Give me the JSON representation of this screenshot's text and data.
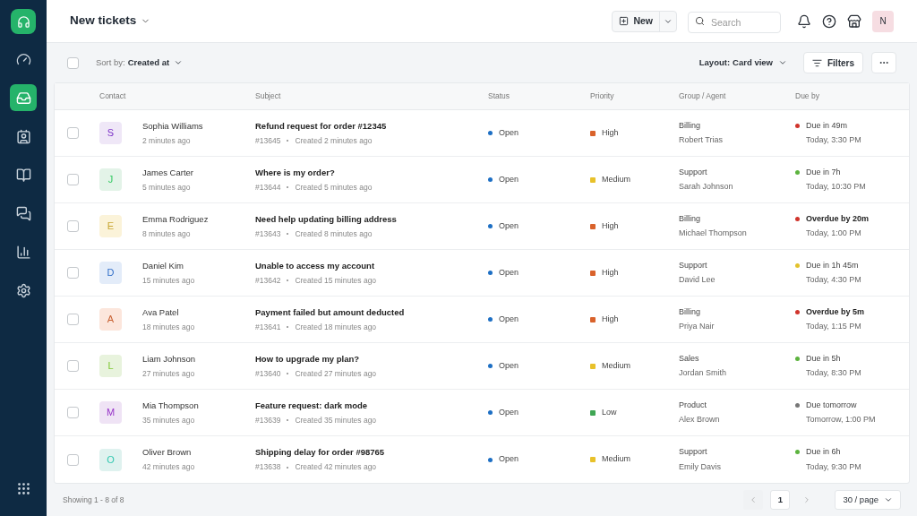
{
  "sidebar": {
    "items": [
      {
        "kind": "dashboard",
        "selected": false
      },
      {
        "kind": "inbox",
        "selected": true
      },
      {
        "kind": "contacts",
        "selected": false
      },
      {
        "kind": "book",
        "selected": false
      },
      {
        "kind": "chat",
        "selected": false
      },
      {
        "kind": "chart",
        "selected": false
      },
      {
        "kind": "settings",
        "selected": false
      }
    ]
  },
  "header": {
    "title": "New tickets",
    "new_button": "New",
    "search": {
      "placeholder": "Search"
    },
    "avatar": "N"
  },
  "toolbar": {
    "select_all_checked": false,
    "sort_label": "Sort by:",
    "sort_value": "Created at",
    "layout_label": "Layout:",
    "layout_value": "Card view",
    "filters": "Filters"
  },
  "table": {
    "columns": [
      "Contact",
      "Subject",
      "Status",
      "Priority",
      "Group / Agent",
      "Due by"
    ],
    "rows": [
      {
        "checked": false,
        "avatar": {
          "letter": "S",
          "color": "#efe7f7"
        },
        "name": "Sophia Williams",
        "time": "2 minutes ago",
        "subject": "Refund request for order #12345",
        "id": "#13645",
        "created": "Created 2 minutes ago",
        "status": {
          "label": "Open",
          "color": "#1d6fc4"
        },
        "priority": {
          "label": "High",
          "color": "#d9622b"
        },
        "group": "Billing",
        "agent": "Robert Trias",
        "due": {
          "label": "Due in 49m",
          "time": "Today, 3:30 PM",
          "color": "#d0342c",
          "overdue": false
        }
      },
      {
        "checked": false,
        "avatar": {
          "letter": "J",
          "color": "#e3f3e8"
        },
        "name": "James Carter",
        "time": "5 minutes ago",
        "subject": "Where is my order?",
        "id": "#13644",
        "created": "Created 5 minutes ago",
        "status": {
          "label": "Open",
          "color": "#1d6fc4"
        },
        "priority": {
          "label": "Medium",
          "color": "#e8c12a"
        },
        "group": "Support",
        "agent": "Sarah Johnson",
        "due": {
          "label": "Due in 7h",
          "time": "Today, 10:30 PM",
          "color": "#5cb33e",
          "overdue": false
        }
      },
      {
        "checked": false,
        "avatar": {
          "letter": "E",
          "color": "#fbf3d9"
        },
        "name": "Emma Rodriguez",
        "time": "8 minutes ago",
        "subject": "Need help updating billing address",
        "id": "#13643",
        "created": "Created 8 minutes ago",
        "status": {
          "label": "Open",
          "color": "#1d6fc4"
        },
        "priority": {
          "label": "High",
          "color": "#d9622b"
        },
        "group": "Billing",
        "agent": "Michael Thompson",
        "due": {
          "label": "Overdue by 20m",
          "time": "Today, 1:00 PM",
          "color": "#d0342c",
          "overdue": true
        }
      },
      {
        "checked": false,
        "avatar": {
          "letter": "D",
          "color": "#e3ecf9"
        },
        "name": "Daniel Kim",
        "time": "15 minutes ago",
        "subject": "Unable to access my account",
        "id": "#13642",
        "created": "Created 15 minutes ago",
        "status": {
          "label": "Open",
          "color": "#1d6fc4"
        },
        "priority": {
          "label": "High",
          "color": "#d9622b"
        },
        "group": "Support",
        "agent": "David Lee",
        "due": {
          "label": "Due in 1h 45m",
          "time": "Today, 4:30 PM",
          "color": "#e3c22c",
          "overdue": false
        }
      },
      {
        "checked": false,
        "avatar": {
          "letter": "A",
          "color": "#fce6dc"
        },
        "name": "Ava Patel",
        "time": "18 minutes ago",
        "subject": "Payment failed but amount deducted",
        "id": "#13641",
        "created": "Created 18 minutes ago",
        "status": {
          "label": "Open",
          "color": "#1d6fc4"
        },
        "priority": {
          "label": "High",
          "color": "#d9622b"
        },
        "group": "Billing",
        "agent": "Priya Nair",
        "due": {
          "label": "Overdue by 5m",
          "time": "Today, 1:15 PM",
          "color": "#d0342c",
          "overdue": true
        }
      },
      {
        "checked": false,
        "avatar": {
          "letter": "L",
          "color": "#e8f3dd"
        },
        "name": "Liam Johnson",
        "time": "27 minutes ago",
        "subject": "How to upgrade my plan?",
        "id": "#13640",
        "created": "Created 27 minutes ago",
        "status": {
          "label": "Open",
          "color": "#1d6fc4"
        },
        "priority": {
          "label": "Medium",
          "color": "#e8c12a"
        },
        "group": "Sales",
        "agent": "Jordan Smith",
        "due": {
          "label": "Due in 5h",
          "time": "Today, 8:30 PM",
          "color": "#5cb33e",
          "overdue": false
        }
      },
      {
        "checked": false,
        "avatar": {
          "letter": "M",
          "color": "#efe3f5"
        },
        "name": "Mia Thompson",
        "time": "35 minutes ago",
        "subject": "Feature request: dark mode",
        "id": "#13639",
        "created": "Created 35 minutes ago",
        "status": {
          "label": "Open",
          "color": "#1d6fc4"
        },
        "priority": {
          "label": "Low",
          "color": "#3fa654"
        },
        "group": "Product",
        "agent": "Alex Brown",
        "due": {
          "label": "Due tomorrow",
          "time": "Tomorrow, 1:00 PM",
          "color": "#777777",
          "overdue": false
        }
      },
      {
        "checked": false,
        "avatar": {
          "letter": "O",
          "color": "#dff2ef"
        },
        "name": "Oliver Brown",
        "time": "42 minutes ago",
        "subject": "Shipping delay for order #98765",
        "id": "#13638",
        "created": "Created 42 minutes ago",
        "status": {
          "label": "Open",
          "color": "#1d6fc4"
        },
        "priority": {
          "label": "Medium",
          "color": "#e8c12a"
        },
        "group": "Support",
        "agent": "Emily Davis",
        "due": {
          "label": "Due in 6h",
          "time": "Today, 9:30 PM",
          "color": "#5cb33e",
          "overdue": false
        }
      }
    ]
  },
  "footer": {
    "showing": "Showing 1 - 8 of 8",
    "page": "1",
    "per_page": "30 / page"
  }
}
